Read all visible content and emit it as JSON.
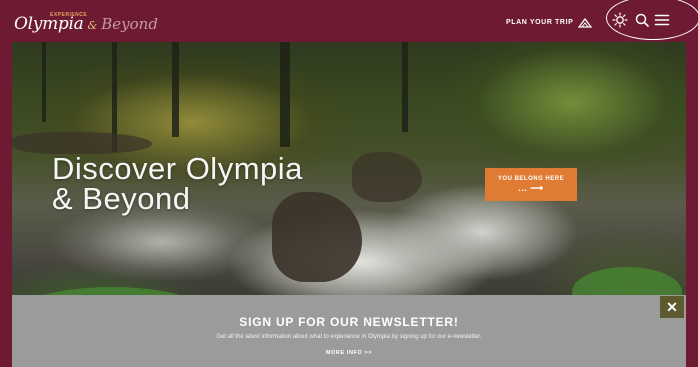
{
  "header": {
    "logo": {
      "tagline": "Experience",
      "main": "Olympia",
      "amp": "&",
      "beyond": "Beyond"
    },
    "plan_trip_label": "PLAN YOUR TRIP",
    "icons": [
      "mountain-icon",
      "weather-sun-icon",
      "search-icon",
      "hamburger-menu-icon"
    ]
  },
  "hero": {
    "title_line1": "Discover Olympia",
    "title_line2": "& Beyond",
    "cta_label": "YOU BELONG HERE",
    "cta_arrow": "... ⟶"
  },
  "newsletter": {
    "title": "SIGN UP FOR OUR NEWSLETTER!",
    "description": "Get all the latest information about what to experience in Olympia by signing up for our e-newsletter.",
    "more_info": "MORE INFO >>",
    "close_label": "✕"
  },
  "colors": {
    "brand": "#6e1a32",
    "accent": "#e07b33",
    "newsletter_bg": "#9b9b9b",
    "close_bg": "#5c5a2e"
  }
}
